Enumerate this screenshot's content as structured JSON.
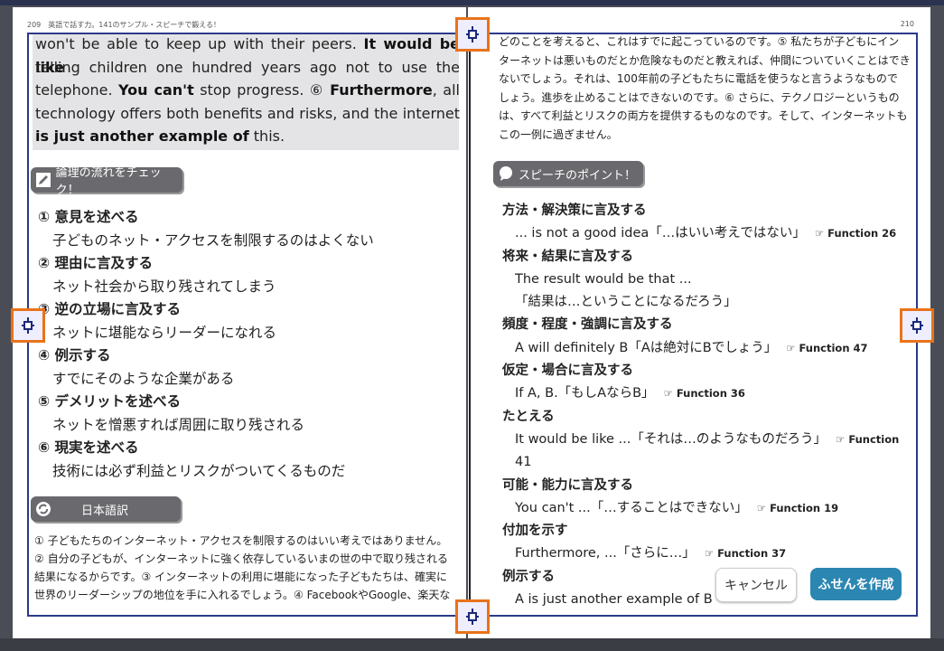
{
  "left_page": {
    "header": "209　英語で話す力。141のサンプル・スピーチで鍛える！",
    "english_lines": [
      "won't be able to keep up with their peers. <b>It would be like</b>",
      "telling children one hundred years ago not to use the",
      "telephone. <b>You can't</b> stop progress. ⑥ <b>Furthermore</b>, all",
      "technology offers both benefits and risks, and the internet",
      "<b>is just another example of</b> this."
    ],
    "logic_tag": "論理の流れをチェック！",
    "logic_items": [
      {
        "h": "① 意見を述べる",
        "d": "子どものネット・アクセスを制限するのはよくない"
      },
      {
        "h": "② 理由に言及する",
        "d": "ネット社会から取り残されてしまう"
      },
      {
        "h": "③ 逆の立場に言及する",
        "d": "ネットに堪能ならリーダーになれる"
      },
      {
        "h": "④ 例示する",
        "d": "すでにそのような企業がある"
      },
      {
        "h": "⑤ デメリットを述べる",
        "d": "ネットを憎悪すれば周囲に取り残される"
      },
      {
        "h": "⑥ 現実を述べる",
        "d": "技術には必ず利益とリスクがついてくるものだ"
      }
    ],
    "translation_tag": "日本語訳",
    "translation_lines": [
      "① 子どもたちのインターネット・アクセスを制限するのはいい考えではありません。",
      "② 自分の子どもが、インターネットに強く依存しているいまの世の中で取り残される",
      "結果になるからです。③ インターネットの利用に堪能になった子どもたちは、確実に",
      "世界のリーダーシップの地位を手に入れるでしょう。④ FacebookやGoogle、楽天な"
    ]
  },
  "right_page": {
    "page_number": "210",
    "translation_lines": [
      "どのことを考えると、これはすでに起こっているのです。⑤ 私たちが子どもにイン",
      "ターネットは悪いものだとか危険なものだと教えれば、仲間についていくことはでき",
      "ないでしょう。それは、100年前の子どもたちに電話を使うなと言うようなもので",
      "しょう。進歩を止めることはできないのです。⑥ さらに、テクノロジーというもの",
      "は、すべて利益とリスクの両方を提供するものなのです。そして、インターネットも",
      "この一例に過ぎません。"
    ],
    "points_tag": "スピーチのポイント！",
    "points": [
      {
        "h": "方法・解決策に言及する",
        "d": [
          {
            "t": "... is not a good idea「…はいい考えではない」",
            "fn": "☞ Function 26"
          }
        ]
      },
      {
        "h": "将来・結果に言及する",
        "d": [
          {
            "t": "The result would be that ...",
            "fn": ""
          },
          {
            "t": "「結果は…ということになるだろう」",
            "fn": ""
          }
        ]
      },
      {
        "h": "頻度・程度・強調に言及する",
        "d": [
          {
            "t": "A will definitely B「Aは絶対にBでしょう」",
            "fn": "☞ Function 47"
          }
        ]
      },
      {
        "h": "仮定・場合に言及する",
        "d": [
          {
            "t": "If A, B.「もしAならB」",
            "fn": "☞ Function 36"
          }
        ]
      },
      {
        "h": "たとえる",
        "d": [
          {
            "t": "It would be like ...「それは…のようなものだろう」",
            "fn": "☞ Function"
          },
          {
            "t": "41",
            "fn": ""
          }
        ]
      },
      {
        "h": "可能・能力に言及する",
        "d": [
          {
            "t": "You can't ...「…することはできない」",
            "fn": "☞ Function 19"
          }
        ]
      },
      {
        "h": "付加を示す",
        "d": [
          {
            "t": "Furthermore, ...「さらに…」",
            "fn": "☞ Function 37"
          }
        ]
      },
      {
        "h": "例示する",
        "d": [
          {
            "t": "A is just another example of B",
            "fn": ""
          }
        ]
      }
    ]
  },
  "buttons": {
    "cancel": "キャンセル",
    "create": "ふせんを作成"
  },
  "colors": {
    "accent": "#e8731a",
    "selection_border": "#2a3a8a",
    "create_button": "#2b86b2"
  }
}
